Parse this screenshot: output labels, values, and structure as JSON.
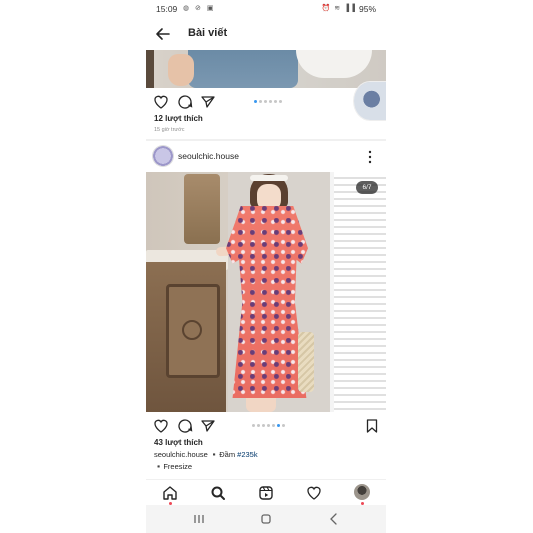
{
  "status_bar": {
    "time": "15:09",
    "left_icons": [
      "messenger-icon",
      "gallery-icon",
      "image-icon"
    ],
    "battery": "95%"
  },
  "header": {
    "title": "Bài viết",
    "back_icon": "arrow-left-icon"
  },
  "prev_post": {
    "likes": "12 lượt thích",
    "time_ago": "15 giờ trước",
    "carousel_dots": 6,
    "carousel_active": 1
  },
  "post": {
    "username": "seoulchic.house",
    "image_counter": "6/7",
    "carousel_dots": 7,
    "carousel_active": 5,
    "likes": "43 lượt thích",
    "caption_user": "seoulchic.house",
    "caption_text": "▪️Đầm",
    "caption_tag": "#235k",
    "caption_line2": "▪️Freesize"
  },
  "bottom_nav": [
    "home-icon",
    "search-icon",
    "reels-icon",
    "heart-icon",
    "profile-avatar"
  ],
  "android_nav": [
    "recents-icon",
    "home-button-icon",
    "back-icon"
  ],
  "colors": {
    "accent_blue": "#3897f0",
    "notify_red": "#ed4956",
    "text": "#262626",
    "muted": "#8e8e8e"
  }
}
